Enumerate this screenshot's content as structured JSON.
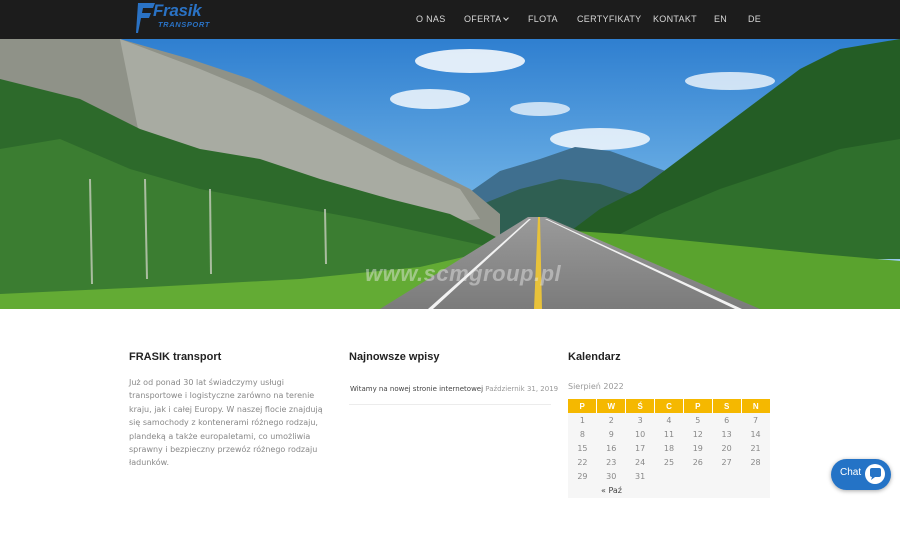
{
  "header": {
    "logo_title": "Frasik",
    "logo_subtitle": "TRANSPORT",
    "nav": [
      {
        "label": "O NAS"
      },
      {
        "label": "OFERTA"
      },
      {
        "label": "FLOTA"
      },
      {
        "label": "CERTYFIKATY"
      },
      {
        "label": "KONTAKT"
      },
      {
        "label": "EN"
      },
      {
        "label": "DE"
      }
    ],
    "dropdown_icon": "chevron-down-icon"
  },
  "hero": {
    "watermark": "www.scmgroup.pl"
  },
  "about": {
    "title": "FRASIK transport",
    "text": "Już od ponad 30 lat świadczymy usługi transportowe i logistyczne zarówno na terenie kraju, jak i całej Europy. W naszej flocie znajdują się samochody z kontenerami różnego rodzaju, plandeką a także europaletami, co umożliwia sprawny i bezpieczny przewóz różnego rodzaju ładunków."
  },
  "recent_posts": {
    "title": "Najnowsze wpisy",
    "items": [
      {
        "title": "Witamy na nowej stronie internetowej",
        "date": "Październik 31, 2019"
      }
    ]
  },
  "calendar": {
    "title": "Kalendarz",
    "caption": "Sierpień 2022",
    "weekdays": [
      "P",
      "W",
      "Ś",
      "C",
      "P",
      "S",
      "N"
    ],
    "weeks": [
      [
        "1",
        "2",
        "3",
        "4",
        "5",
        "6",
        "7"
      ],
      [
        "8",
        "9",
        "10",
        "11",
        "12",
        "13",
        "14"
      ],
      [
        "15",
        "16",
        "17",
        "18",
        "19",
        "20",
        "21"
      ],
      [
        "22",
        "23",
        "24",
        "25",
        "26",
        "27",
        "28"
      ],
      [
        "29",
        "30",
        "31",
        "",
        "",
        "",
        ""
      ]
    ],
    "prev_link": "« Paź",
    "header_color": "#f5b800"
  },
  "chat": {
    "label": "Chat",
    "icon": "chat-bubble-icon",
    "color": "#2473c6"
  }
}
